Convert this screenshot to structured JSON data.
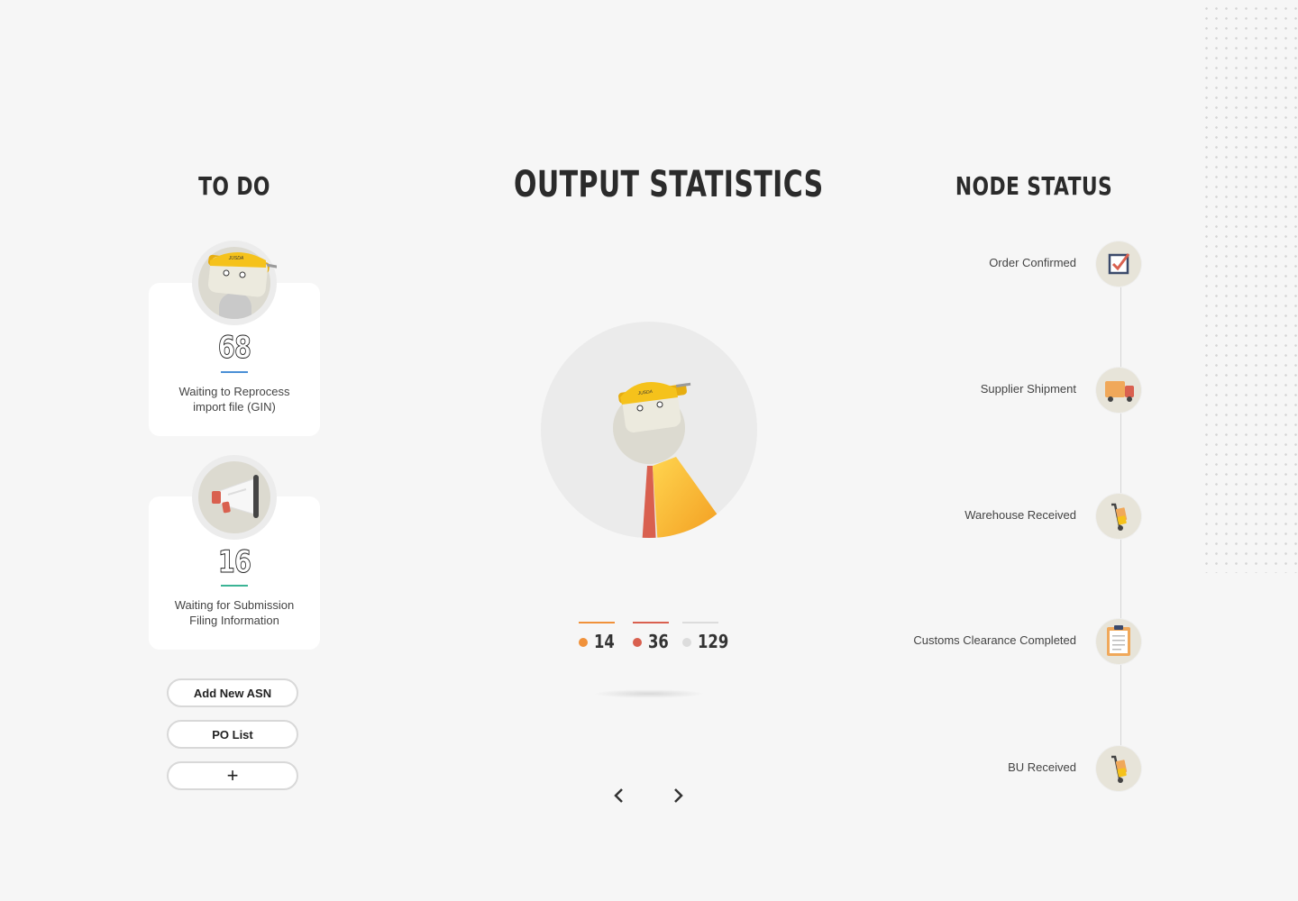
{
  "todo": {
    "title": "TO DO",
    "cards": [
      {
        "count": "68",
        "label": "Waiting to Reprocess import file (GIN)",
        "accent": "#4a8fd6",
        "icon": "robot-mascot-icon"
      },
      {
        "count": "16",
        "label": "Waiting for Submission Filing Information",
        "accent": "#3bb495",
        "icon": "megaphone-icon"
      }
    ],
    "buttons": {
      "add_asn": "Add New ASN",
      "po_list": "PO List",
      "add": "+"
    }
  },
  "output": {
    "title": "OUTPUT STATISTICS",
    "legend": [
      {
        "value": "14",
        "color": "#f0913a"
      },
      {
        "value": "36",
        "color": "#d9604f"
      },
      {
        "value": "129",
        "color": "#d9d9d9"
      }
    ],
    "nav": {
      "prev_icon": "chevron-left-icon",
      "next_icon": "chevron-right-icon"
    }
  },
  "node_status": {
    "title": "NODE STATUS",
    "nodes": [
      {
        "label": "Order Confirmed",
        "icon": "checkbox-icon"
      },
      {
        "label": "Supplier Shipment",
        "icon": "truck-icon"
      },
      {
        "label": "Warehouse Received",
        "icon": "hand-truck-icon"
      },
      {
        "label": "Customs Clearance Completed",
        "icon": "clipboard-icon"
      },
      {
        "label": "BU Received",
        "icon": "hand-truck-icon"
      }
    ]
  },
  "colors": {
    "background": "#f6f6f6",
    "accent_yellow": "#f5c21b",
    "accent_orange": "#f0913a",
    "accent_red": "#d9604f"
  }
}
